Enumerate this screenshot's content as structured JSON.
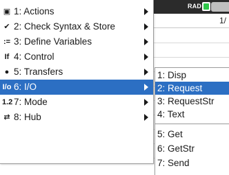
{
  "status_bar": {
    "angle_mode": "RAD",
    "page_indicator": "1/"
  },
  "menu": {
    "items": [
      {
        "icon": "actions-icon",
        "glyph": "▣",
        "label": "1: Actions",
        "has_submenu": true
      },
      {
        "icon": "check-syntax-icon",
        "glyph": "✔",
        "label": "2: Check Syntax & Store",
        "has_submenu": true
      },
      {
        "icon": "define-variables-icon",
        "glyph": ":=",
        "label": "3: Define Variables",
        "has_submenu": true
      },
      {
        "icon": "control-icon",
        "glyph": "If",
        "label": "4: Control",
        "has_submenu": true
      },
      {
        "icon": "transfers-icon",
        "glyph": "●",
        "label": "5: Transfers",
        "has_submenu": true
      },
      {
        "icon": "io-icon",
        "glyph": "I/o",
        "label": "6: I/O",
        "has_submenu": true,
        "selected": true
      },
      {
        "icon": "mode-icon",
        "glyph": "1.2",
        "label": "7: Mode",
        "has_submenu": true
      },
      {
        "icon": "hub-icon",
        "glyph": "⇄",
        "label": "8: Hub",
        "has_submenu": true
      }
    ]
  },
  "submenu": {
    "items": [
      {
        "label": "1: Disp"
      },
      {
        "label": "2: Request",
        "selected": true
      },
      {
        "label": "3: RequestStr"
      },
      {
        "label": "4: Text"
      },
      {
        "label": "5: Get"
      },
      {
        "label": "6: GetStr"
      },
      {
        "label": "7: Send"
      }
    ]
  },
  "colors": {
    "selection": "#2c6fc3",
    "battery": "#2fc64a",
    "topbar": "#2b2b2b"
  }
}
